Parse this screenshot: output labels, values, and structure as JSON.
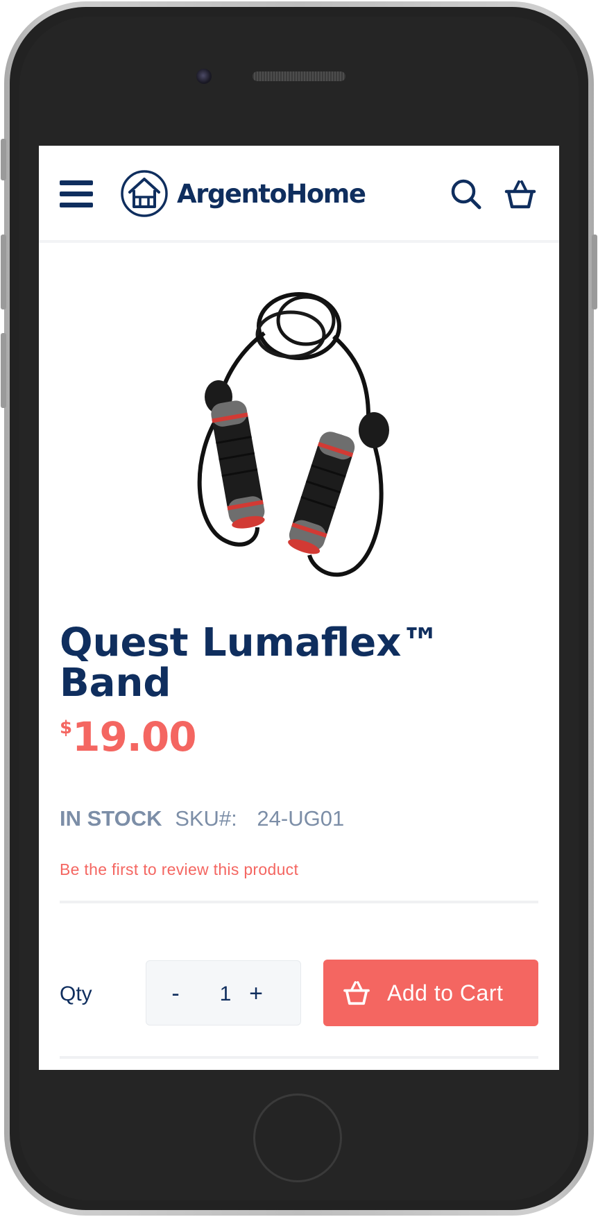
{
  "colors": {
    "navy": "#0f2e5e",
    "accent": "#f46661",
    "muted": "#7c8ea7",
    "qty_bg": "#f5f7f9"
  },
  "header": {
    "menu_icon": "hamburger-menu-icon",
    "logo_icon": "house-icon",
    "logo_text": "ArgentoHome",
    "search_icon": "search-icon",
    "cart_icon": "shopping-basket-icon"
  },
  "product": {
    "image_desc": "jump-rope-icon",
    "title": "Quest Lumaflex™ Band",
    "price_symbol": "$",
    "price_value": "19.00",
    "stock_status": "IN STOCK",
    "sku_label": "SKU#:",
    "sku_value": "24-UG01",
    "review_link": "Be the first to review this product"
  },
  "purchase": {
    "qty_label": "Qty",
    "qty_minus": "-",
    "qty_value": "1",
    "qty_plus": "+",
    "add_to_cart_label": "Add to Cart",
    "add_to_cart_icon": "shopping-basket-icon"
  }
}
